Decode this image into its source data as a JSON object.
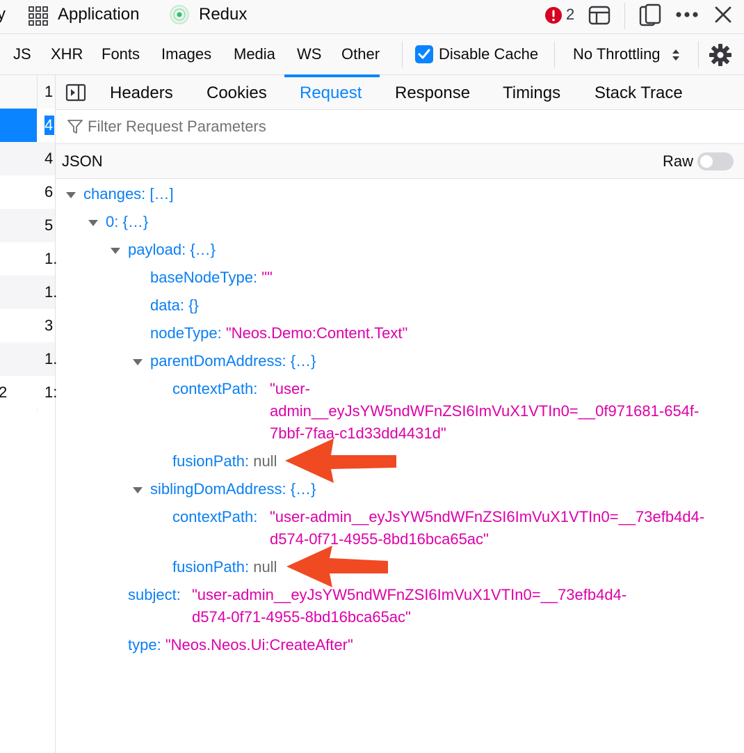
{
  "toolbar": {
    "partial_left": "y",
    "tabs": [
      "Application",
      "Redux"
    ],
    "error_count": "2"
  },
  "typebar": {
    "filters": [
      "JS",
      "XHR",
      "Fonts",
      "Images",
      "Media",
      "WS",
      "Other"
    ],
    "disable_cache_label": "Disable Cache",
    "disable_cache_checked": true,
    "throttling": "No Throttling"
  },
  "request_list": {
    "header_num": "1",
    "rows": [
      {
        "num": "4",
        "selected": true,
        "lead": ""
      },
      {
        "num": "4",
        "selected": false,
        "lead": ""
      },
      {
        "num": "6",
        "selected": false,
        "lead": ""
      },
      {
        "num": "5",
        "selected": false,
        "lead": ""
      },
      {
        "num": "1.",
        "selected": false,
        "lead": ""
      },
      {
        "num": "1.",
        "selected": false,
        "lead": ""
      },
      {
        "num": "3",
        "selected": false,
        "lead": ""
      },
      {
        "num": "1.",
        "selected": false,
        "lead": ""
      },
      {
        "num": "1:",
        "selected": false,
        "lead": "2"
      }
    ]
  },
  "detail": {
    "tabs": [
      "Headers",
      "Cookies",
      "Request",
      "Response",
      "Timings",
      "Stack Trace"
    ],
    "active_tab": "Request",
    "filter_placeholder": "Filter Request Parameters",
    "json_label": "JSON",
    "raw_label": "Raw",
    "raw_enabled": false
  },
  "tree": {
    "changes_key": "changes:",
    "changes_val": "[…]",
    "item0_key": "0:",
    "item0_val": "{…}",
    "payload_key": "payload:",
    "payload_val": "{…}",
    "baseNodeType_key": "baseNodeType:",
    "baseNodeType_val": "\"\"",
    "data_key": "data:",
    "data_val": "{}",
    "nodeType_key": "nodeType:",
    "nodeType_val": "\"Neos.Demo:Content.Text\"",
    "parentDom_key": "parentDomAddress:",
    "parentDom_val": "{…}",
    "p_contextPath_key": "contextPath:",
    "p_contextPath_l1": "\"user-",
    "p_contextPath_l2": "admin__eyJsYW5ndWFnZSI6ImVuX1VTIn0=__0f971681-654f-",
    "p_contextPath_l3": "7bbf-7faa-c1d33dd4431d\"",
    "p_fusionPath_key": "fusionPath:",
    "p_fusionPath_val": "null",
    "siblingDom_key": "siblingDomAddress:",
    "siblingDom_val": "{…}",
    "s_contextPath_key": "contextPath:",
    "s_contextPath_l1": "\"user-admin__eyJsYW5ndWFnZSI6ImVuX1VTIn0=__73efb4d4-",
    "s_contextPath_l2": "d574-0f71-4955-8bd16bca65ac\"",
    "s_fusionPath_key": "fusionPath:",
    "s_fusionPath_val": "null",
    "subject_key": "subject:",
    "subject_l1": "\"user-admin__eyJsYW5ndWFnZSI6ImVuX1VTIn0=__73efb4d4-",
    "subject_l2": "d574-0f71-4955-8bd16bca65ac\"",
    "type_key": "type:",
    "type_val": "\"Neos.Neos.Ui:CreateAfter\""
  },
  "colors": {
    "accent": "#0a84ff",
    "json_key": "#0a7ff2",
    "json_string": "#dd00a9",
    "annotation_arrow": "#f04a23",
    "error_badge": "#d70022"
  }
}
